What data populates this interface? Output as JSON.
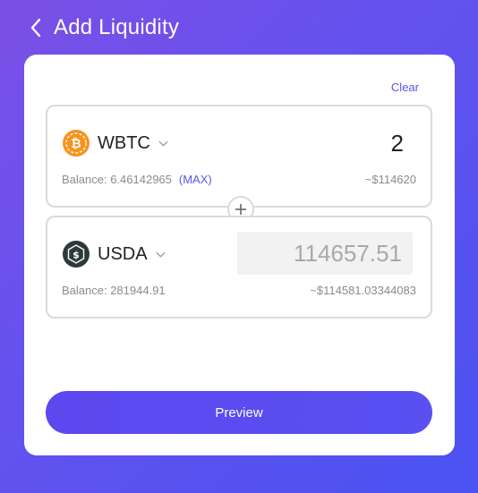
{
  "header": {
    "title": "Add Liquidity"
  },
  "card": {
    "clear_label": "Clear",
    "token_a": {
      "symbol": "WBTC",
      "amount": "2",
      "balance": "Balance: 6.46142965",
      "max_label": "(MAX)",
      "usd_value": "~$114620",
      "logo_color": "#f7931a"
    },
    "token_b": {
      "symbol": "USDA",
      "amount": "114657.51",
      "balance": "Balance: 281944.91",
      "usd_value": "~$114581.03344083",
      "logo_color": "#2d3a3a"
    },
    "preview_label": "Preview"
  },
  "icons": {
    "back": "chevron-left-icon",
    "dropdown": "chevron-down-icon",
    "plus": "plus-icon"
  },
  "colors": {
    "accent": "#5b55e6",
    "border": "#d9d9de"
  }
}
